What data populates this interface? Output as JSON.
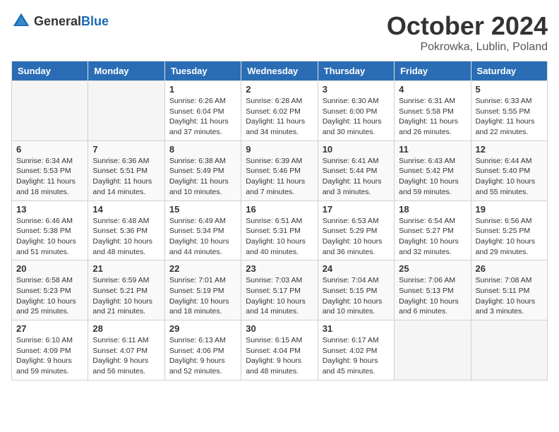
{
  "header": {
    "logo_general": "General",
    "logo_blue": "Blue",
    "month_year": "October 2024",
    "location": "Pokrowka, Lublin, Poland"
  },
  "weekdays": [
    "Sunday",
    "Monday",
    "Tuesday",
    "Wednesday",
    "Thursday",
    "Friday",
    "Saturday"
  ],
  "weeks": [
    [
      {
        "day": "",
        "info": ""
      },
      {
        "day": "",
        "info": ""
      },
      {
        "day": "1",
        "info": "Sunrise: 6:26 AM\nSunset: 6:04 PM\nDaylight: 11 hours and 37 minutes."
      },
      {
        "day": "2",
        "info": "Sunrise: 6:28 AM\nSunset: 6:02 PM\nDaylight: 11 hours and 34 minutes."
      },
      {
        "day": "3",
        "info": "Sunrise: 6:30 AM\nSunset: 6:00 PM\nDaylight: 11 hours and 30 minutes."
      },
      {
        "day": "4",
        "info": "Sunrise: 6:31 AM\nSunset: 5:58 PM\nDaylight: 11 hours and 26 minutes."
      },
      {
        "day": "5",
        "info": "Sunrise: 6:33 AM\nSunset: 5:55 PM\nDaylight: 11 hours and 22 minutes."
      }
    ],
    [
      {
        "day": "6",
        "info": "Sunrise: 6:34 AM\nSunset: 5:53 PM\nDaylight: 11 hours and 18 minutes."
      },
      {
        "day": "7",
        "info": "Sunrise: 6:36 AM\nSunset: 5:51 PM\nDaylight: 11 hours and 14 minutes."
      },
      {
        "day": "8",
        "info": "Sunrise: 6:38 AM\nSunset: 5:49 PM\nDaylight: 11 hours and 10 minutes."
      },
      {
        "day": "9",
        "info": "Sunrise: 6:39 AM\nSunset: 5:46 PM\nDaylight: 11 hours and 7 minutes."
      },
      {
        "day": "10",
        "info": "Sunrise: 6:41 AM\nSunset: 5:44 PM\nDaylight: 11 hours and 3 minutes."
      },
      {
        "day": "11",
        "info": "Sunrise: 6:43 AM\nSunset: 5:42 PM\nDaylight: 10 hours and 59 minutes."
      },
      {
        "day": "12",
        "info": "Sunrise: 6:44 AM\nSunset: 5:40 PM\nDaylight: 10 hours and 55 minutes."
      }
    ],
    [
      {
        "day": "13",
        "info": "Sunrise: 6:46 AM\nSunset: 5:38 PM\nDaylight: 10 hours and 51 minutes."
      },
      {
        "day": "14",
        "info": "Sunrise: 6:48 AM\nSunset: 5:36 PM\nDaylight: 10 hours and 48 minutes."
      },
      {
        "day": "15",
        "info": "Sunrise: 6:49 AM\nSunset: 5:34 PM\nDaylight: 10 hours and 44 minutes."
      },
      {
        "day": "16",
        "info": "Sunrise: 6:51 AM\nSunset: 5:31 PM\nDaylight: 10 hours and 40 minutes."
      },
      {
        "day": "17",
        "info": "Sunrise: 6:53 AM\nSunset: 5:29 PM\nDaylight: 10 hours and 36 minutes."
      },
      {
        "day": "18",
        "info": "Sunrise: 6:54 AM\nSunset: 5:27 PM\nDaylight: 10 hours and 32 minutes."
      },
      {
        "day": "19",
        "info": "Sunrise: 6:56 AM\nSunset: 5:25 PM\nDaylight: 10 hours and 29 minutes."
      }
    ],
    [
      {
        "day": "20",
        "info": "Sunrise: 6:58 AM\nSunset: 5:23 PM\nDaylight: 10 hours and 25 minutes."
      },
      {
        "day": "21",
        "info": "Sunrise: 6:59 AM\nSunset: 5:21 PM\nDaylight: 10 hours and 21 minutes."
      },
      {
        "day": "22",
        "info": "Sunrise: 7:01 AM\nSunset: 5:19 PM\nDaylight: 10 hours and 18 minutes."
      },
      {
        "day": "23",
        "info": "Sunrise: 7:03 AM\nSunset: 5:17 PM\nDaylight: 10 hours and 14 minutes."
      },
      {
        "day": "24",
        "info": "Sunrise: 7:04 AM\nSunset: 5:15 PM\nDaylight: 10 hours and 10 minutes."
      },
      {
        "day": "25",
        "info": "Sunrise: 7:06 AM\nSunset: 5:13 PM\nDaylight: 10 hours and 6 minutes."
      },
      {
        "day": "26",
        "info": "Sunrise: 7:08 AM\nSunset: 5:11 PM\nDaylight: 10 hours and 3 minutes."
      }
    ],
    [
      {
        "day": "27",
        "info": "Sunrise: 6:10 AM\nSunset: 4:09 PM\nDaylight: 9 hours and 59 minutes."
      },
      {
        "day": "28",
        "info": "Sunrise: 6:11 AM\nSunset: 4:07 PM\nDaylight: 9 hours and 56 minutes."
      },
      {
        "day": "29",
        "info": "Sunrise: 6:13 AM\nSunset: 4:06 PM\nDaylight: 9 hours and 52 minutes."
      },
      {
        "day": "30",
        "info": "Sunrise: 6:15 AM\nSunset: 4:04 PM\nDaylight: 9 hours and 48 minutes."
      },
      {
        "day": "31",
        "info": "Sunrise: 6:17 AM\nSunset: 4:02 PM\nDaylight: 9 hours and 45 minutes."
      },
      {
        "day": "",
        "info": ""
      },
      {
        "day": "",
        "info": ""
      }
    ]
  ]
}
